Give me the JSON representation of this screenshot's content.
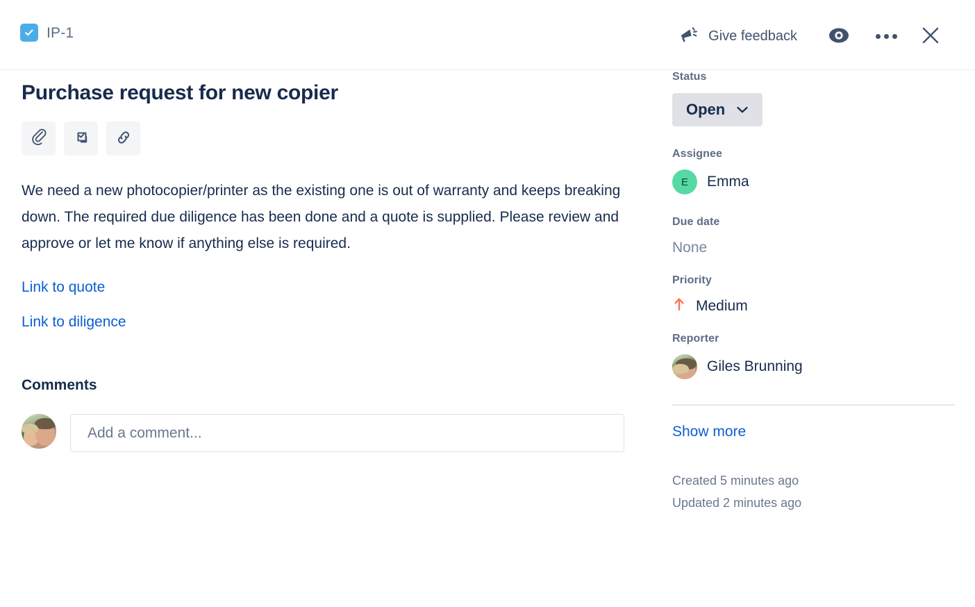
{
  "header": {
    "issue_key": "IP-1",
    "task_icon": "task-checkbox-icon",
    "feedback_label": "Give feedback",
    "megaphone_icon": "megaphone-icon",
    "watch_icon": "eye-watch-icon",
    "more_icon": "more-options-icon",
    "close_icon": "close-icon"
  },
  "main": {
    "title": "Purchase request for new copier",
    "actions": [
      {
        "name": "attach-button",
        "icon": "paperclip-icon"
      },
      {
        "name": "add-child-issue-button",
        "icon": "child-issue-icon"
      },
      {
        "name": "link-issue-button",
        "icon": "link-chain-icon"
      }
    ],
    "description": "We need a new photocopier/printer as the existing one is out of warranty and keeps breaking down. The required due diligence has been done and a quote is supplied. Please review and approve or let me know if anything else is required.",
    "links": [
      {
        "label": "Link to quote"
      },
      {
        "label": "Link to diligence"
      }
    ],
    "comments_heading": "Comments",
    "comment_placeholder": "Add a comment...",
    "comment_value": ""
  },
  "sidebar": {
    "status_label": "Status",
    "status_value": "Open",
    "assignee_label": "Assignee",
    "assignee_name": "Emma",
    "assignee_initial": "E",
    "due_date_label": "Due date",
    "due_date_value": "None",
    "priority_label": "Priority",
    "priority_value": "Medium",
    "priority_icon": "priority-medium-arrow-up-icon",
    "reporter_label": "Reporter",
    "reporter_name": "Giles Brunning",
    "show_more_label": "Show more",
    "created_text": "Created 5 minutes ago",
    "updated_text": "Updated 2 minutes ago"
  },
  "colors": {
    "task_icon_blue": "#4bade8",
    "link_blue": "#0b5fd1",
    "assignee_avatar_green": "#57d9a3",
    "priority_orange": "#ff7452",
    "status_pill_grey": "#dfe1e6",
    "text_dark": "#172b4d",
    "text_muted": "#5e6c84"
  }
}
